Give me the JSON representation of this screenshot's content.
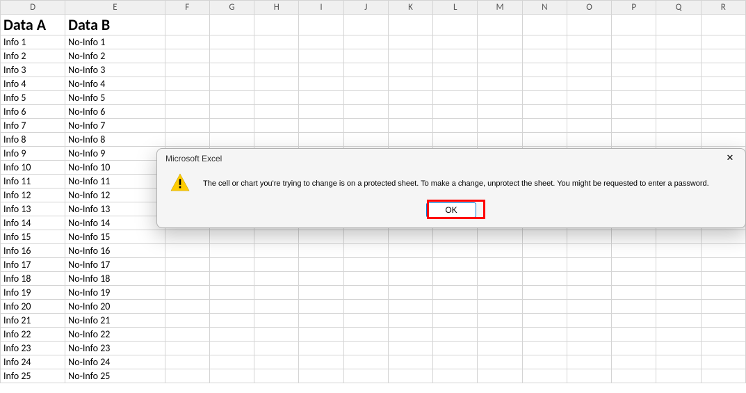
{
  "columns": [
    "D",
    "E",
    "F",
    "G",
    "H",
    "I",
    "J",
    "K",
    "L",
    "M",
    "N",
    "O",
    "P",
    "Q",
    "R"
  ],
  "headers": {
    "D": "Data A",
    "E": "Data B"
  },
  "rows": [
    {
      "D": "Info 1",
      "E": "No-Info 1"
    },
    {
      "D": "Info 2",
      "E": "No-Info 2"
    },
    {
      "D": "Info 3",
      "E": "No-Info 3"
    },
    {
      "D": "Info 4",
      "E": "No-Info 4"
    },
    {
      "D": "Info 5",
      "E": "No-Info 5"
    },
    {
      "D": "Info 6",
      "E": "No-Info 6"
    },
    {
      "D": "Info 7",
      "E": "No-Info 7"
    },
    {
      "D": "Info 8",
      "E": "No-Info 8"
    },
    {
      "D": "Info 9",
      "E": "No-Info 9"
    },
    {
      "D": "Info 10",
      "E": "No-Info 10"
    },
    {
      "D": "Info 11",
      "E": "No-Info 11"
    },
    {
      "D": "Info 12",
      "E": "No-Info 12"
    },
    {
      "D": "Info 13",
      "E": "No-Info 13"
    },
    {
      "D": "Info 14",
      "E": "No-Info 14"
    },
    {
      "D": "Info 15",
      "E": "No-Info 15"
    },
    {
      "D": "Info 16",
      "E": "No-Info 16"
    },
    {
      "D": "Info 17",
      "E": "No-Info 17"
    },
    {
      "D": "Info 18",
      "E": "No-Info 18"
    },
    {
      "D": "Info 19",
      "E": "No-Info 19"
    },
    {
      "D": "Info 20",
      "E": "No-Info 20"
    },
    {
      "D": "Info 21",
      "E": "No-Info 21"
    },
    {
      "D": "Info 22",
      "E": "No-Info 22"
    },
    {
      "D": "Info 23",
      "E": "No-Info 23"
    },
    {
      "D": "Info 24",
      "E": "No-Info 24"
    },
    {
      "D": "Info 25",
      "E": "No-Info 25"
    }
  ],
  "dialog": {
    "title": "Microsoft Excel",
    "message": "The cell or chart you're trying to change is on a protected sheet. To make a change, unprotect the sheet. You might be requested to enter a password.",
    "ok_label": "OK"
  }
}
